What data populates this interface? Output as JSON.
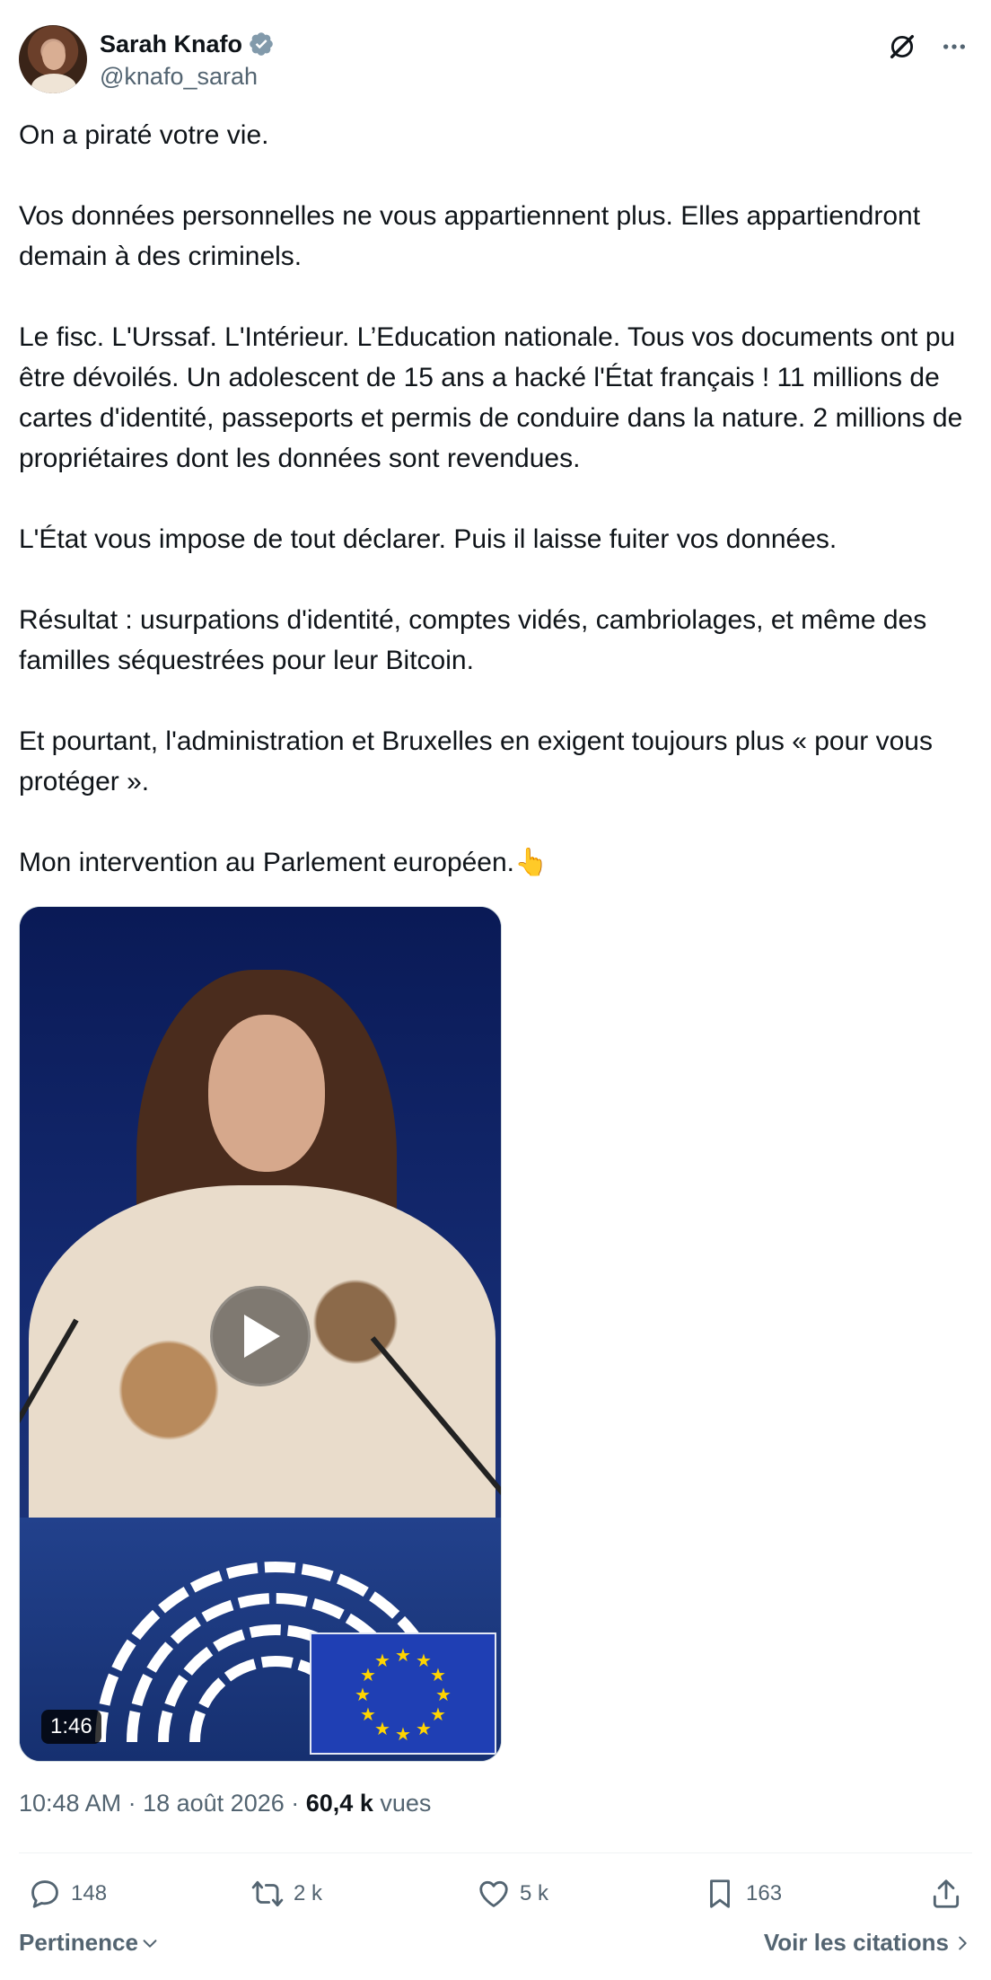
{
  "author": {
    "name": "Sarah Knafo",
    "handle": "@knafo_sarah",
    "verified_color": "#829aab"
  },
  "tweet": {
    "paragraphs": [
      "On a piraté votre vie.",
      "Vos données personnelles ne vous appartiennent plus. Elles appartiendront demain à des criminels.",
      "Le fisc. L'Urssaf. L'Intérieur. L’Education nationale. Tous vos documents ont pu être dévoilés. Un adolescent de 15 ans a hacké l'État français ! 11 millions de cartes d'identité, passeports et permis de conduire dans la nature. 2 millions de propriétaires dont les données sont revendues.",
      "L'État vous impose de tout déclarer. Puis il laisse fuiter vos données.",
      "Résultat : usurpations d'identité, comptes vidés, cambriolages, et même des familles séquestrées pour leur Bitcoin.",
      "Et pourtant, l'administration et Bruxelles en exigent toujours plus « pour vous protéger ».",
      "Mon intervention au Parlement européen.👆"
    ]
  },
  "video": {
    "duration": "1:46"
  },
  "meta": {
    "time": "10:48 AM",
    "date": "18 août 2026",
    "views_count": "60,4 k",
    "views_label": "vues"
  },
  "actions": {
    "replies": "148",
    "reposts": "2 k",
    "likes": "5 k",
    "bookmarks": "163"
  },
  "footer": {
    "sort_label": "Pertinence",
    "quotes_label": "Voir les citations"
  },
  "colors": {
    "text": "#0f1419",
    "secondary": "#536471",
    "border": "#eff3f4"
  }
}
